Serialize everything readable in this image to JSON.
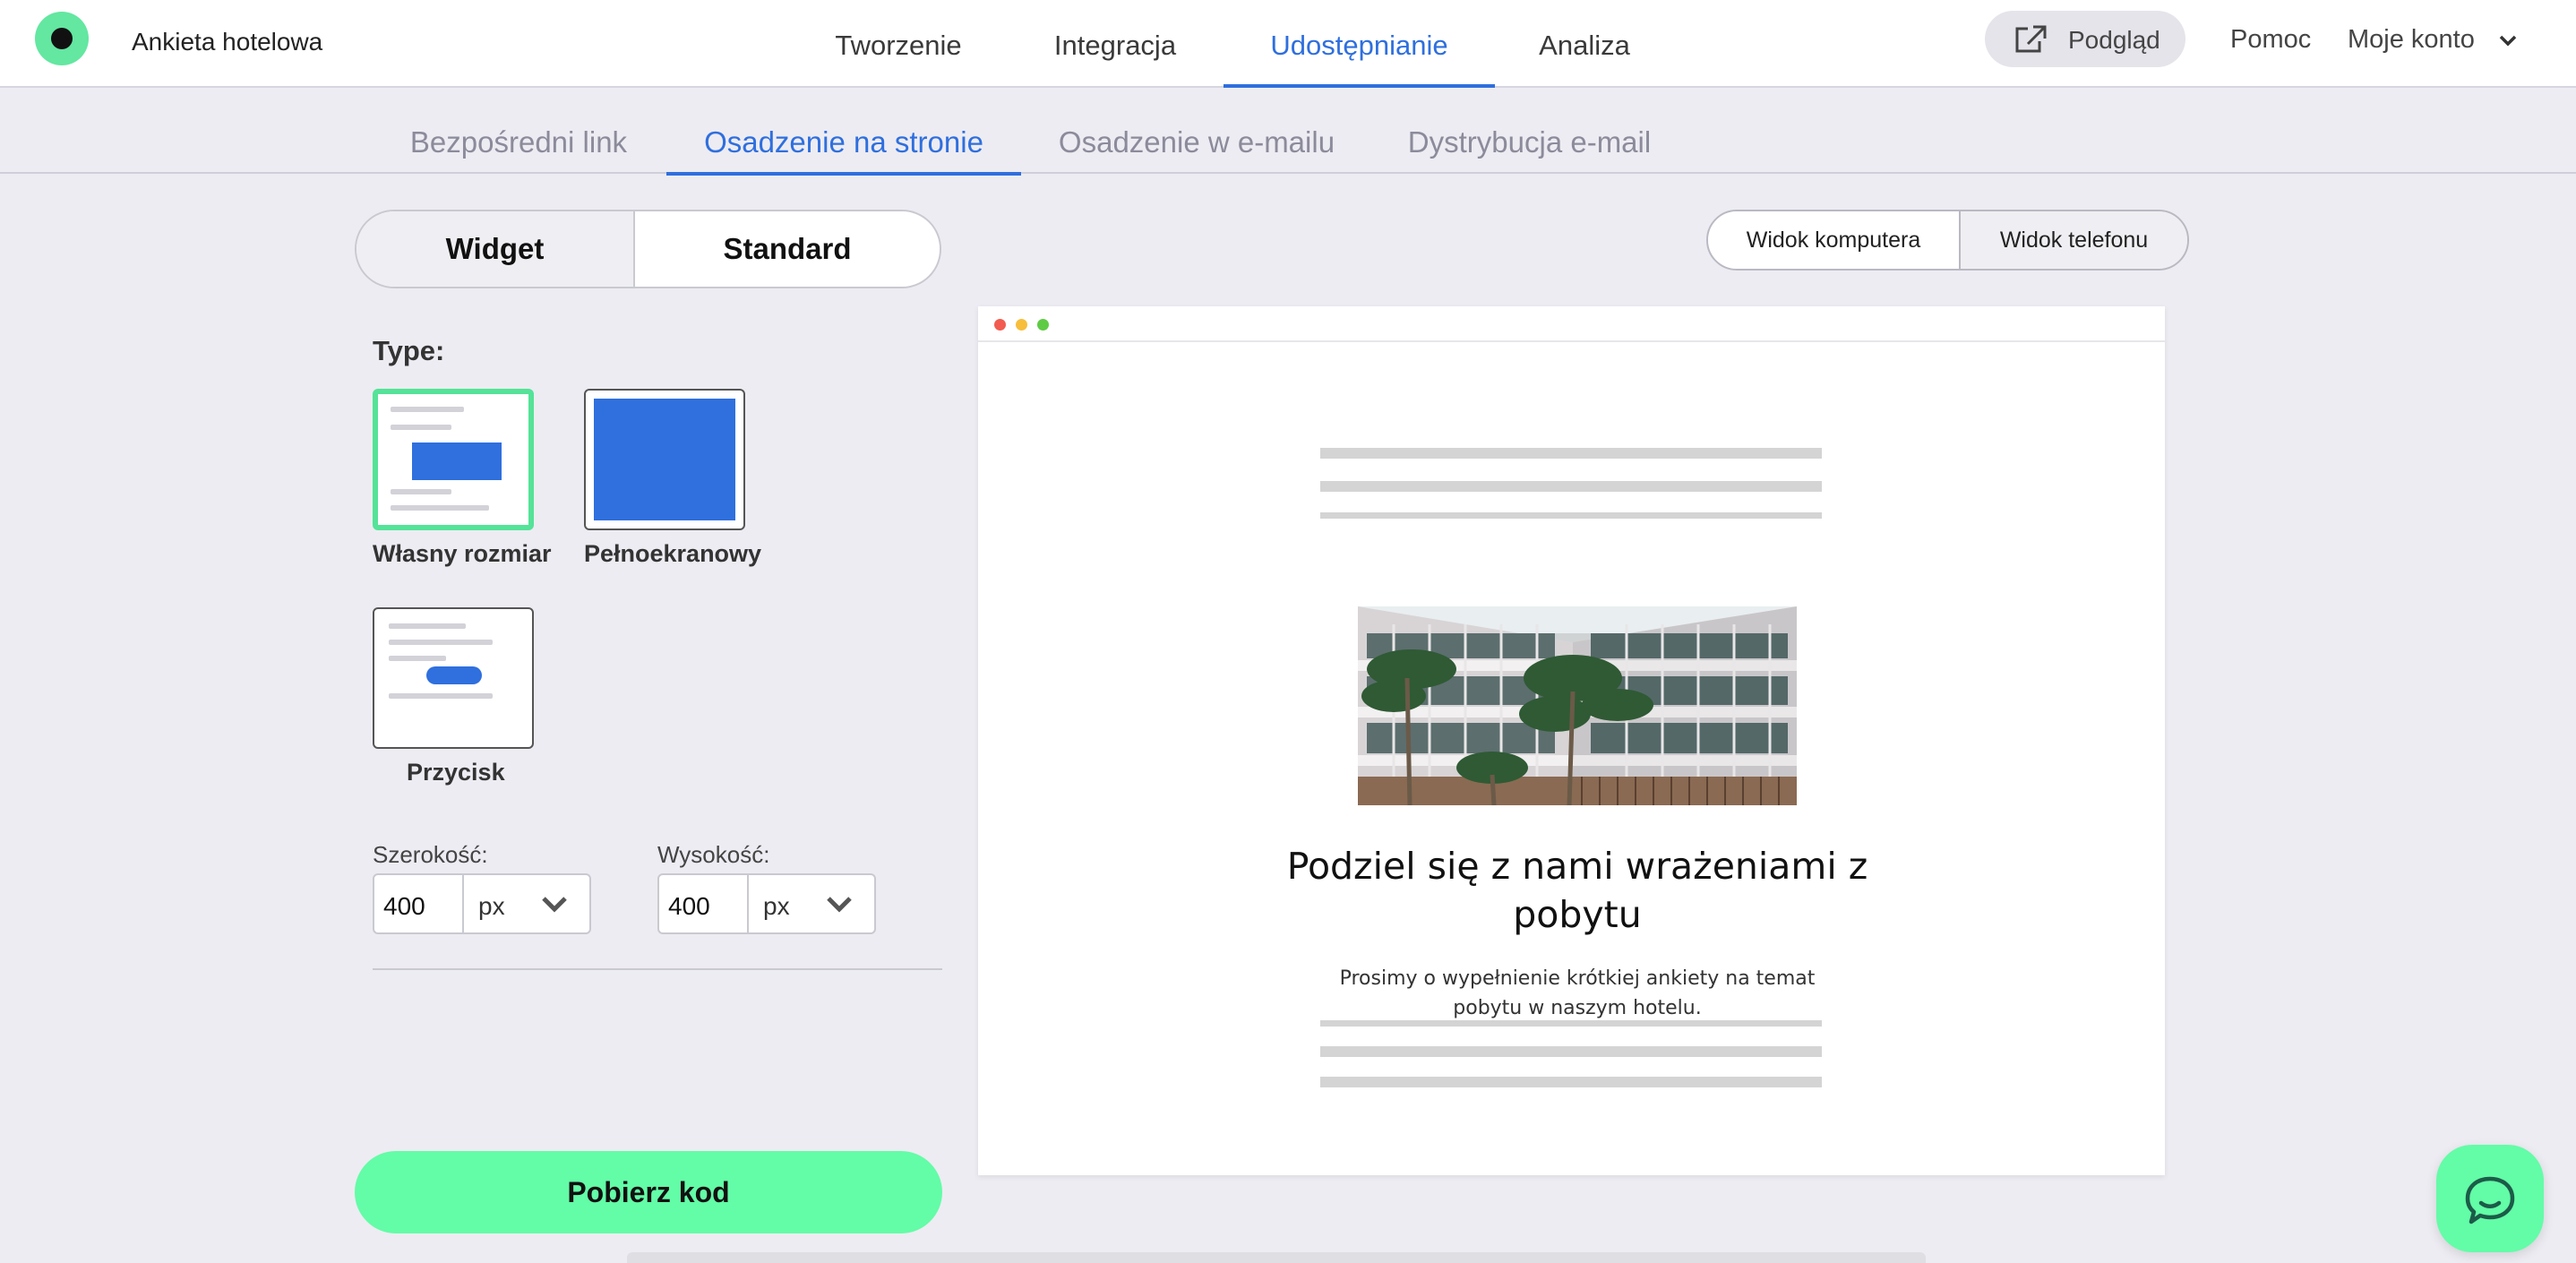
{
  "header": {
    "app_title": "Ankieta hotelowa",
    "tabs": [
      {
        "label": "Tworzenie"
      },
      {
        "label": "Integracja"
      },
      {
        "label": "Udostępnianie"
      },
      {
        "label": "Analiza"
      }
    ],
    "active_tab": "Udostępnianie",
    "preview_label": "Podgląd",
    "help_label": "Pomoc",
    "account_label": "Moje konto"
  },
  "subtabs": {
    "items": [
      {
        "label": "Bezpośredni link"
      },
      {
        "label": "Osadzenie na stronie"
      },
      {
        "label": "Osadzenie w e-mailu"
      },
      {
        "label": "Dystrybucja e-mail"
      }
    ],
    "active": "Osadzenie na stronie"
  },
  "embed_mode": {
    "options": [
      {
        "label": "Widget"
      },
      {
        "label": "Standard"
      }
    ],
    "selected": "Standard"
  },
  "type_selector": {
    "label": "Type:",
    "options": [
      {
        "label": "Własny rozmiar",
        "selected": true
      },
      {
        "label": "Pełnoekranowy",
        "selected": false
      },
      {
        "label": "Przycisk",
        "selected": false
      }
    ]
  },
  "size": {
    "width": {
      "label": "Szerokość:",
      "value": "400",
      "unit": "px"
    },
    "height": {
      "label": "Wysokość:",
      "value": "400",
      "unit": "px"
    }
  },
  "get_code_label": "Pobierz kod",
  "view_toggle": {
    "options": [
      {
        "label": "Widok komputera"
      },
      {
        "label": "Widok telefonu"
      }
    ],
    "selected": "Widok komputera"
  },
  "preview": {
    "title": "Podziel się z nami wrażeniami z pobytu",
    "description": "Prosimy o wypełnienie krótkiej ankiety na temat pobytu w naszym hotelu."
  },
  "colors": {
    "accent_blue": "#2f6fde",
    "brand_green": "#63fca7",
    "selected_border": "#54e398"
  },
  "icons": {
    "preview": "external-link-icon",
    "account": "chevron-down-icon",
    "chat": "chat-bubble-icon"
  }
}
